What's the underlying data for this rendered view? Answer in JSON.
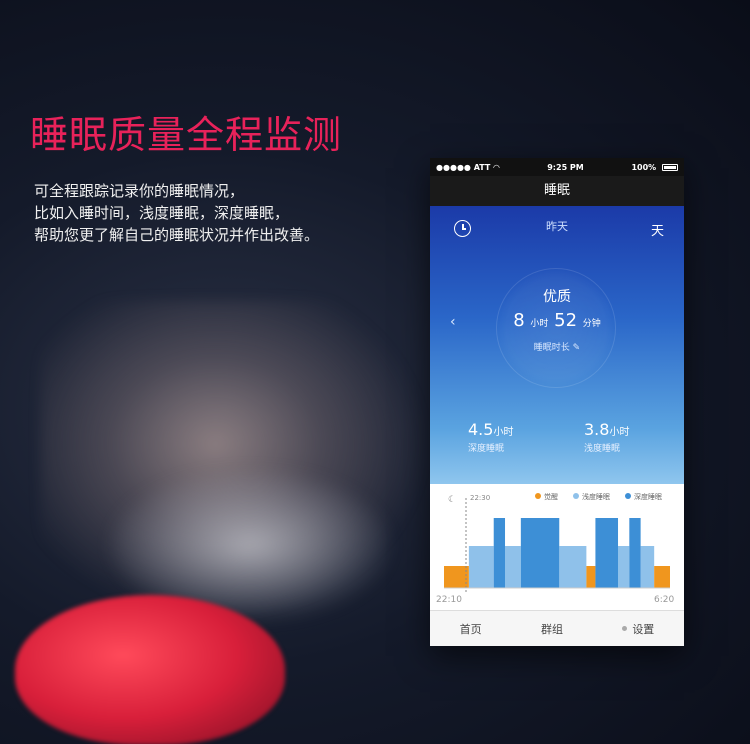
{
  "headline": "睡眠质量全程监测",
  "description": [
    "可全程跟踪记录你的睡眠情况，",
    "比如入睡时间，浅度睡眠，深度睡眠，",
    "帮助您更了解自己的睡眠状况并作出改善。"
  ],
  "phone": {
    "status": {
      "carrier": "●●●●● ATT",
      "time": "9:25 PM",
      "battery": "100%"
    },
    "title": "睡眠",
    "day_label": "昨天",
    "day_button": "天",
    "quality": "优质",
    "duration": {
      "hours": "8",
      "hours_unit": "小时",
      "minutes": "52",
      "minutes_unit": "分钟"
    },
    "duration_label": "睡眠时长",
    "deep": {
      "value": "4.5",
      "unit": "小时",
      "label": "深度睡眠"
    },
    "light": {
      "value": "3.8",
      "unit": "小时",
      "label": "浅度睡眠"
    },
    "tabs": [
      "首页",
      "群组",
      "设置"
    ]
  },
  "chart_data": {
    "type": "bar",
    "marker_time": "22:30",
    "start_label": "22:10",
    "end_label": "6:20",
    "legend": [
      {
        "name": "觉醒",
        "color": "#f0961e"
      },
      {
        "name": "浅度睡眠",
        "color": "#8fc1ea"
      },
      {
        "name": "深度睡眠",
        "color": "#3d8fd6"
      }
    ],
    "segments": [
      {
        "state": "觉醒",
        "start": 0,
        "end": 0.11
      },
      {
        "state": "浅度睡眠",
        "start": 0.11,
        "end": 0.22
      },
      {
        "state": "深度睡眠",
        "start": 0.22,
        "end": 0.27
      },
      {
        "state": "浅度睡眠",
        "start": 0.27,
        "end": 0.34
      },
      {
        "state": "深度睡眠",
        "start": 0.34,
        "end": 0.51
      },
      {
        "state": "浅度睡眠",
        "start": 0.51,
        "end": 0.63
      },
      {
        "state": "觉醒",
        "start": 0.63,
        "end": 0.67
      },
      {
        "state": "深度睡眠",
        "start": 0.67,
        "end": 0.77
      },
      {
        "state": "浅度睡眠",
        "start": 0.77,
        "end": 0.82
      },
      {
        "state": "深度睡眠",
        "start": 0.82,
        "end": 0.87
      },
      {
        "state": "浅度睡眠",
        "start": 0.87,
        "end": 0.93
      },
      {
        "state": "觉醒",
        "start": 0.93,
        "end": 1.0
      }
    ]
  }
}
